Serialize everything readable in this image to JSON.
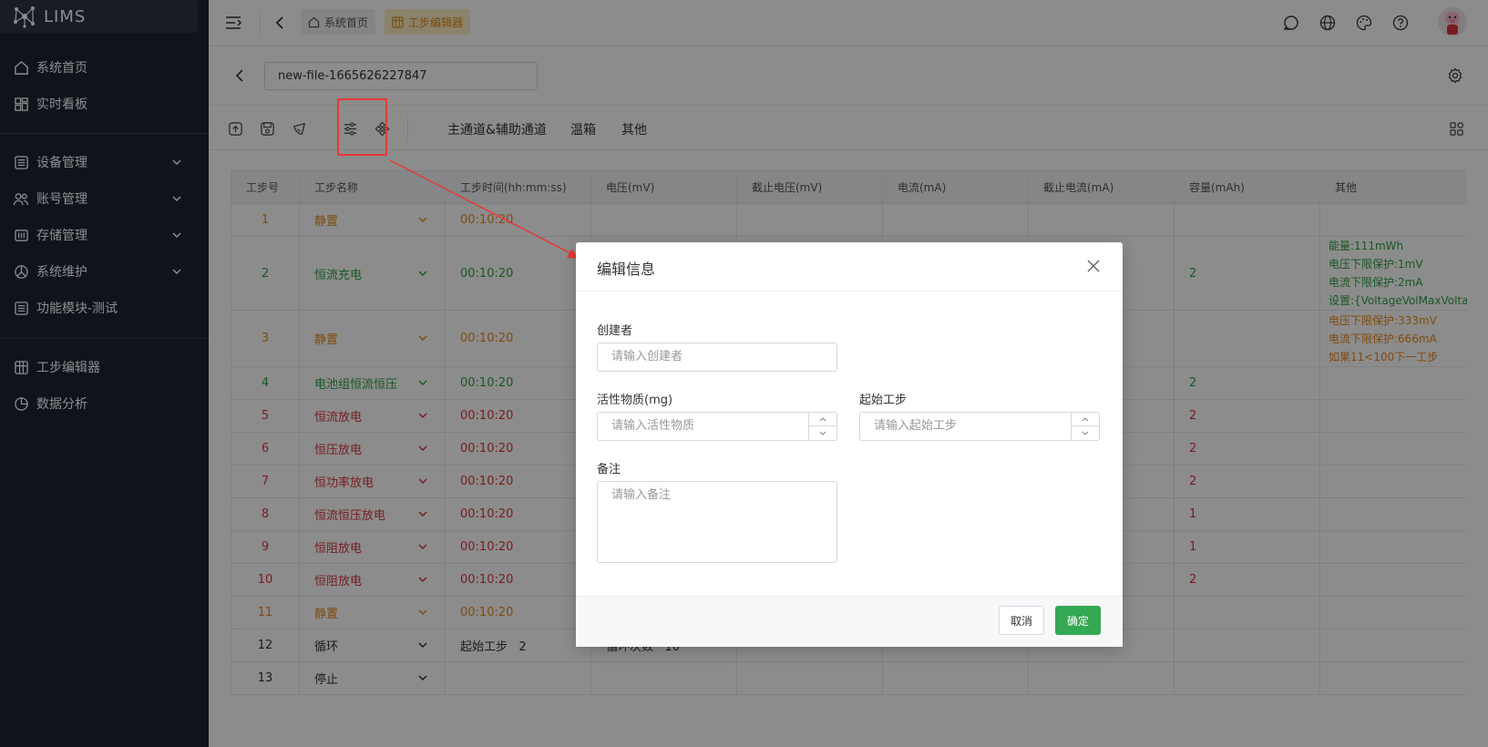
{
  "app": {
    "title": "LIMS"
  },
  "sidebar": {
    "items": [
      {
        "label": "系统首页",
        "icon": "home-icon"
      },
      {
        "label": "实时看板",
        "icon": "dashboard-icon"
      },
      {
        "label": "设备管理",
        "icon": "device-icon"
      },
      {
        "label": "账号管理",
        "icon": "users-icon"
      },
      {
        "label": "存储管理",
        "icon": "storage-icon"
      },
      {
        "label": "系统维护",
        "icon": "maintenance-icon"
      },
      {
        "label": "功能模块-测试",
        "icon": "module-icon"
      },
      {
        "label": "工步编辑器",
        "icon": "editor-icon"
      },
      {
        "label": "数据分析",
        "icon": "analysis-icon"
      }
    ]
  },
  "header": {
    "tabs": [
      {
        "label": "系统首页"
      },
      {
        "label": "工步编辑器"
      }
    ]
  },
  "editor": {
    "file_name": "new-file-1665626227847",
    "toolbar": {
      "channel_label": "主通道&辅助通道",
      "chamber_label": "温箱",
      "other_label": "其他"
    }
  },
  "table": {
    "headers": [
      "工步号",
      "工步名称",
      "工步时间(hh:mm:ss)",
      "电压(mV)",
      "截止电压(mV)",
      "电流(mA)",
      "截止电流(mA)",
      "容量(mAh)",
      "其他"
    ],
    "rows": [
      {
        "no": "1",
        "name": "静置",
        "time": "00:10:20",
        "cap": "",
        "other": [],
        "color": "orange"
      },
      {
        "no": "2",
        "name": "恒流充电",
        "time": "00:10:20",
        "cap": "2",
        "other": [
          "能量:111mWh",
          "电压下限保护:1mV",
          "电流下限保护:2mA",
          "设置:{VoltageVolMaxVoltag"
        ],
        "color": "green"
      },
      {
        "no": "3",
        "name": "静置",
        "time": "00:10:20",
        "cap": "",
        "other": [
          "电压下限保护:333mV",
          "电流下限保护:666mA",
          "如果11<100下一工步"
        ],
        "color": "orange"
      },
      {
        "no": "4",
        "name": "电池组恒流恒压",
        "time": "00:10:20",
        "cap": "2",
        "other": [],
        "color": "green"
      },
      {
        "no": "5",
        "name": "恒流放电",
        "time": "00:10:20",
        "cap": "2",
        "other": [],
        "color": "red"
      },
      {
        "no": "6",
        "name": "恒压放电",
        "time": "00:10:20",
        "cap": "2",
        "other": [],
        "color": "red"
      },
      {
        "no": "7",
        "name": "恒功率放电",
        "time": "00:10:20",
        "cap": "2",
        "other": [],
        "color": "red"
      },
      {
        "no": "8",
        "name": "恒流恒压放电",
        "time": "00:10:20",
        "cap": "1",
        "other": [],
        "color": "red"
      },
      {
        "no": "9",
        "name": "恒阻放电",
        "time": "00:10:20",
        "cap": "1",
        "other": [],
        "color": "red"
      },
      {
        "no": "10",
        "name": "恒阻放电",
        "time": "00:10:20",
        "cap": "2",
        "other": [],
        "color": "red"
      },
      {
        "no": "11",
        "name": "静置",
        "time": "00:10:20",
        "cap": "",
        "other": [],
        "color": "orange"
      },
      {
        "no": "12",
        "name": "循环",
        "time": "起始工步",
        "time_value": "2",
        "volt": "循环次数",
        "volt_value": "10",
        "cap": "",
        "other": [],
        "color": "dark"
      },
      {
        "no": "13",
        "name": "停止",
        "time": "",
        "cap": "",
        "other": [],
        "color": "dark"
      }
    ]
  },
  "modal": {
    "title": "编辑信息",
    "creator_label": "创建者",
    "creator_placeholder": "请输入创建者",
    "active_label": "活性物质(mg)",
    "active_placeholder": "请输入活性物质",
    "start_label": "起始工步",
    "start_placeholder": "请输入起始工步",
    "remark_label": "备注",
    "remark_placeholder": "请输入备注",
    "cancel_label": "取消",
    "ok_label": "确定"
  },
  "colors": {
    "sidebar_bg": "#1d2434",
    "accent_green": "#34a853",
    "orange": "#e8891a",
    "red": "#d9363e",
    "annotation_red": "#e53935"
  }
}
